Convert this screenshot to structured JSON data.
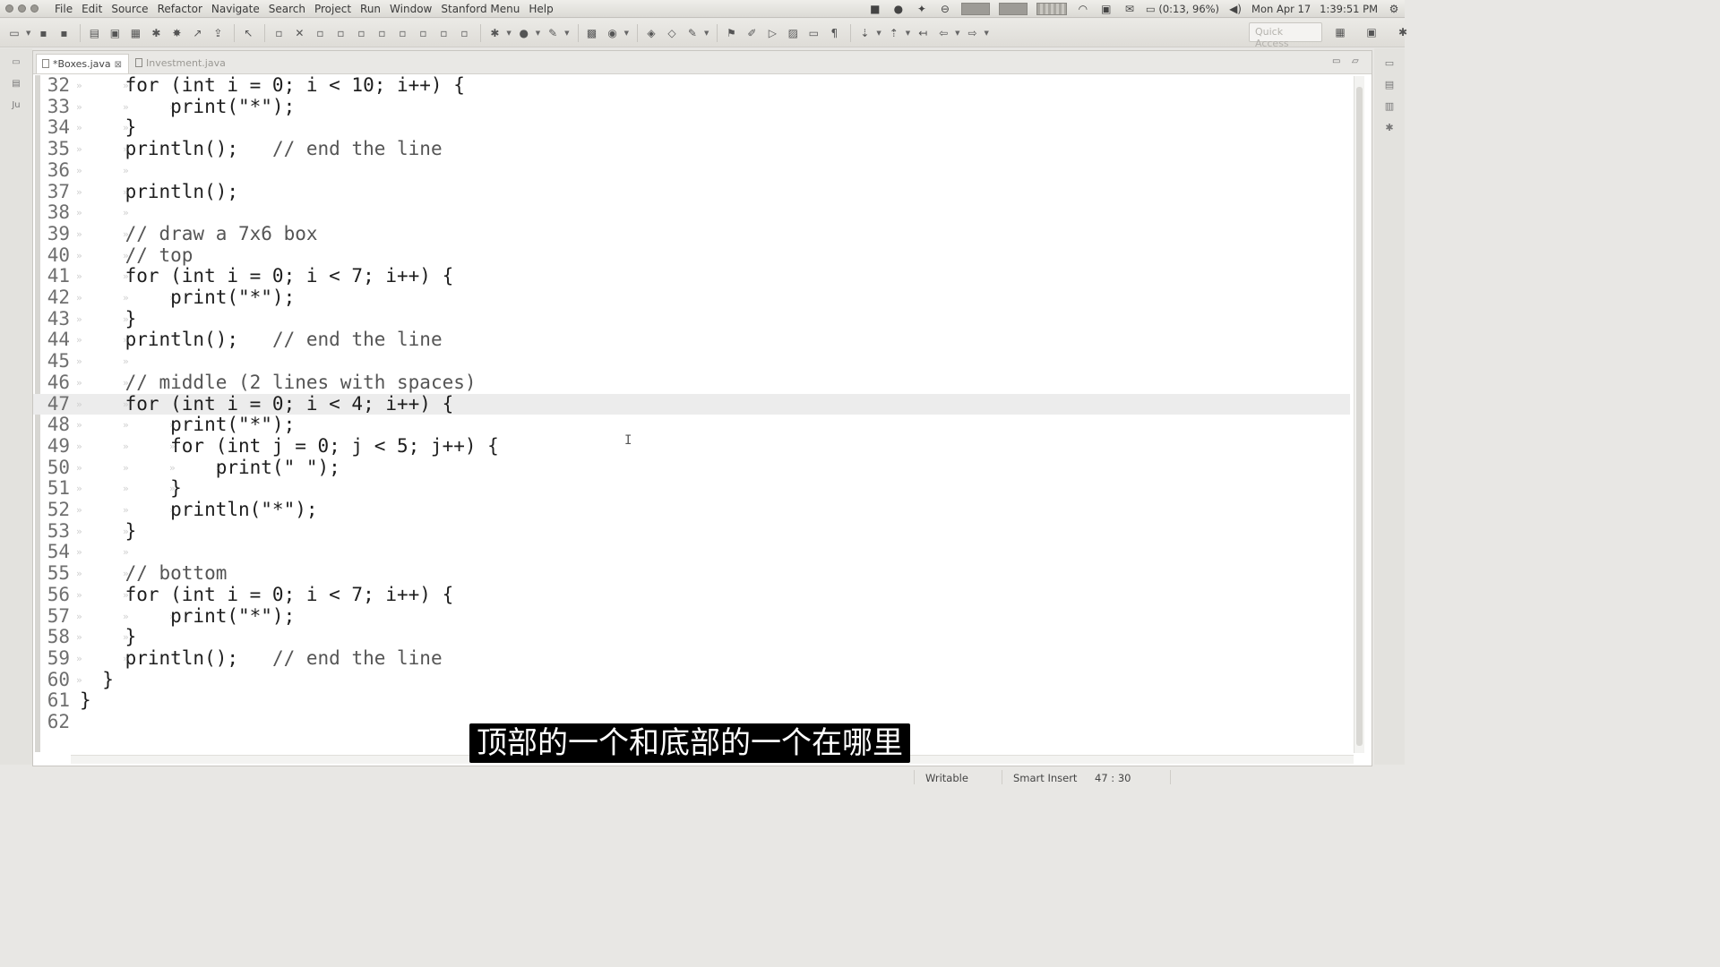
{
  "menubar": {
    "items": [
      "File",
      "Edit",
      "Source",
      "Refactor",
      "Navigate",
      "Search",
      "Project",
      "Run",
      "Window",
      "Stanford Menu",
      "Help"
    ],
    "battery": "(0:13, 96%)",
    "date": "Mon Apr 17",
    "time": "1:39:51 PM"
  },
  "toolbar": {
    "quick_access_placeholder": "Quick Access"
  },
  "tabs": [
    {
      "label": "*Boxes.java",
      "close": "⊠",
      "active": true
    },
    {
      "label": "Investment.java",
      "active": false
    }
  ],
  "editor": {
    "lines": [
      {
        "no": "32",
        "code": "    for (int i = 0; i < 10; i++) {",
        "indent": 2
      },
      {
        "no": "33",
        "code": "        print(\"*\");",
        "indent": 3
      },
      {
        "no": "34",
        "code": "    }",
        "indent": 2
      },
      {
        "no": "35",
        "code": "    println();   ",
        "comment": "// end the line",
        "indent": 2
      },
      {
        "no": "36",
        "code": "",
        "indent": 2
      },
      {
        "no": "37",
        "code": "    println();",
        "indent": 2
      },
      {
        "no": "38",
        "code": "",
        "indent": 2
      },
      {
        "no": "39",
        "code": "    ",
        "comment": "// draw a 7x6 box",
        "indent": 2
      },
      {
        "no": "40",
        "code": "    ",
        "comment": "// top",
        "indent": 2
      },
      {
        "no": "41",
        "code": "    for (int i = 0; i < 7; i++) {",
        "indent": 2
      },
      {
        "no": "42",
        "code": "        print(\"*\");",
        "indent": 3
      },
      {
        "no": "43",
        "code": "    }",
        "indent": 2
      },
      {
        "no": "44",
        "code": "    println();   ",
        "comment": "// end the line",
        "indent": 2
      },
      {
        "no": "45",
        "code": "",
        "indent": 2
      },
      {
        "no": "46",
        "code": "    ",
        "comment": "// middle (2 lines with spaces)",
        "indent": 2
      },
      {
        "no": "47",
        "code": "    for (int i = 0; i < 4; i++) {",
        "indent": 2,
        "current": true
      },
      {
        "no": "48",
        "code": "        print(\"*\");",
        "indent": 3
      },
      {
        "no": "49",
        "code": "        for (int j = 0; j < 5; j++) {",
        "indent": 3
      },
      {
        "no": "50",
        "code": "            print(\" \");",
        "indent": 4
      },
      {
        "no": "51",
        "code": "        }",
        "indent": 3
      },
      {
        "no": "52",
        "code": "        println(\"*\");",
        "indent": 3
      },
      {
        "no": "53",
        "code": "    }",
        "indent": 2
      },
      {
        "no": "54",
        "code": "",
        "indent": 2
      },
      {
        "no": "55",
        "code": "    ",
        "comment": "// bottom",
        "indent": 2
      },
      {
        "no": "56",
        "code": "    for (int i = 0; i < 7; i++) {",
        "indent": 2
      },
      {
        "no": "57",
        "code": "        print(\"*\");",
        "indent": 3
      },
      {
        "no": "58",
        "code": "    }",
        "indent": 2
      },
      {
        "no": "59",
        "code": "    println();   ",
        "comment": "// end the line",
        "indent": 2
      },
      {
        "no": "60",
        "code": "  }",
        "indent": 1
      },
      {
        "no": "61",
        "code": "}",
        "indent": 0
      },
      {
        "no": "62",
        "code": "",
        "indent": 0
      }
    ]
  },
  "statusbar": {
    "writable": "Writable",
    "insert_mode": "Smart Insert",
    "position": "47 : 30"
  },
  "subtitle": "顶部的一个和底部的一个在哪里"
}
